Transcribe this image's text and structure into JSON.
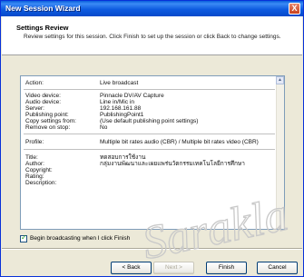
{
  "window": {
    "title": "New Session Wizard",
    "close_glyph": "X"
  },
  "header": {
    "title": "Settings Review",
    "description": "Review settings for this session. Click Finish to set up the session or click Back to change settings."
  },
  "review": {
    "action_label": "Action:",
    "action_value": "Live broadcast",
    "rows1": [
      {
        "label": "Video device:",
        "value": "Pinnacle DV/AV Capture"
      },
      {
        "label": "Audio device:",
        "value": "Line in/Mic in"
      },
      {
        "label": "Server:",
        "value": "192.168.161.88"
      },
      {
        "label": "Publishing point:",
        "value": "PublishingPoint1"
      },
      {
        "label": "Copy settings from:",
        "value": "(Use default publishing point settings)"
      },
      {
        "label": "Remove on stop:",
        "value": "No"
      }
    ],
    "profile_label": "Profile:",
    "profile_value": "Multiple bit rates audio (CBR) / Multiple bit rates video (CBR)",
    "rows2": [
      {
        "label": "Title:",
        "value": "ทดสอบการใช้งาน"
      },
      {
        "label": "Author:",
        "value": "กลุ่มงานพัฒนาและเผยแพร่นวัตกรรมเทคโนโลยีการศึกษา"
      },
      {
        "label": "Copyright:",
        "value": ""
      },
      {
        "label": "Rating:",
        "value": ""
      },
      {
        "label": "Description:",
        "value": ""
      }
    ],
    "scroll_up_glyph": "▲"
  },
  "begin_checkbox": {
    "label": "Begin broadcasting when I click Finish",
    "checked": true
  },
  "buttons": {
    "back": "< Back",
    "next": "Next >",
    "finish": "Finish",
    "cancel": "Cancel"
  },
  "watermark": {
    "text": "Sarakla"
  }
}
